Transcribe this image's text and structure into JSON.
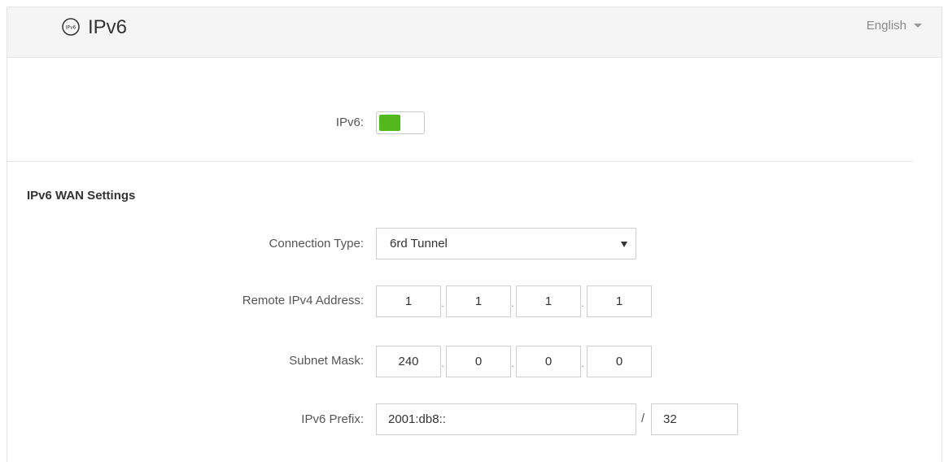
{
  "header": {
    "title": "IPv6",
    "title_icon": "ipv6-badge-icon",
    "language": "English"
  },
  "ipv6_toggle": {
    "label": "IPv6:",
    "state": "on",
    "on_color": "#53b71d"
  },
  "wan_settings": {
    "title": "IPv6 WAN Settings",
    "connection_type": {
      "label": "Connection Type:",
      "value": "6rd Tunnel"
    },
    "remote_ipv4": {
      "label": "Remote IPv4 Address:",
      "octets": [
        "1",
        "1",
        "1",
        "1"
      ]
    },
    "subnet_mask": {
      "label": "Subnet Mask:",
      "octets": [
        "240",
        "0",
        "0",
        "0"
      ]
    },
    "ipv6_prefix": {
      "label": "IPv6 Prefix:",
      "value": "2001:db8::",
      "separator": "/",
      "length": "32"
    },
    "octet_separator": "."
  }
}
